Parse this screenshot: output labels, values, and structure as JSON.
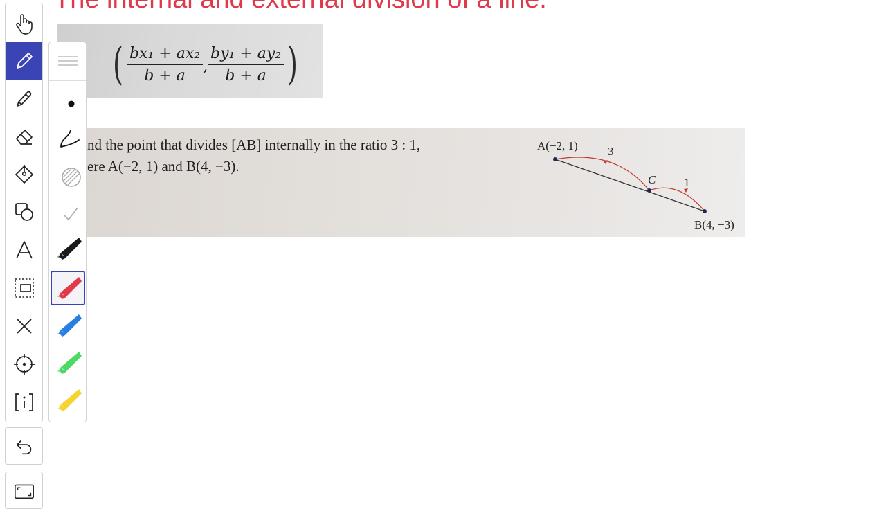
{
  "title": "The internal and external division of a line.",
  "formula": {
    "num1": "bx₁ + ax₂",
    "den1": "b + a",
    "num2": "by₁ + ay₂",
    "den2": "b + a",
    "left_paren": "(",
    "comma": ",",
    "right_paren": ")"
  },
  "problem": {
    "line1": "nd the point that divides [AB] internally in the ratio 3 : 1,",
    "line2": "ere A(−2, 1) and B(4, −3)."
  },
  "diagram": {
    "label_a": "A(−2, 1)",
    "label_b": "B(4, −3)",
    "label_c": "C",
    "ratio_left": "3",
    "ratio_right": "1"
  },
  "toolbar": {
    "tools": [
      "hand-icon",
      "pen-icon",
      "highlighter-icon",
      "eraser-icon",
      "fill-icon",
      "shapes-icon",
      "text-icon",
      "select-icon",
      "clear-icon",
      "laser-pointer-icon",
      "info-icon"
    ],
    "active_tool": "pen-icon",
    "undo": "undo-icon",
    "fullscreen": "fullscreen-icon"
  },
  "pen_options": {
    "options": [
      "stroke-width-icon",
      "dot-icon",
      "freehand-stroke-icon",
      "texture-icon",
      "check-icon"
    ],
    "colors": [
      "#1a1a1a",
      "#e23a4a",
      "#2a7de1",
      "#4cd964",
      "#f5d431"
    ],
    "selected_color": "#e23a4a"
  }
}
